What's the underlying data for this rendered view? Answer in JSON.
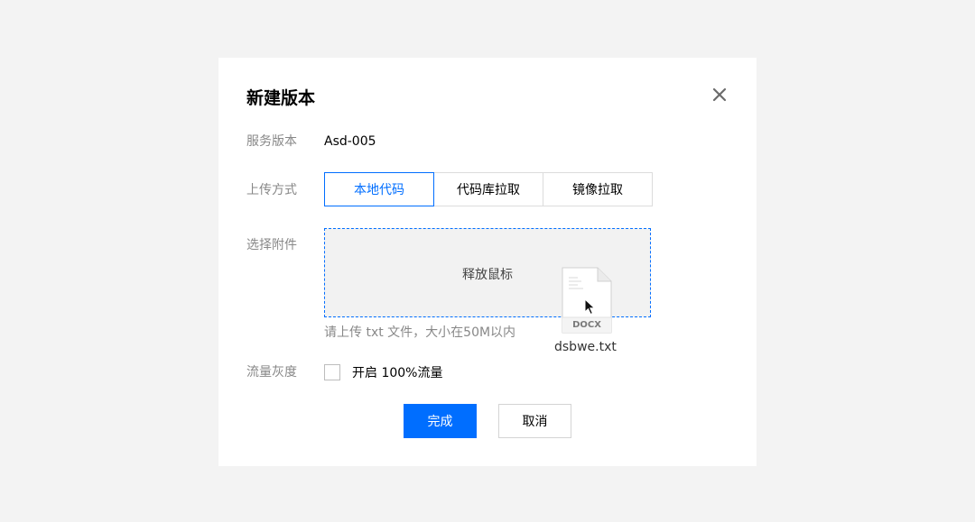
{
  "dialog": {
    "title": "新建版本",
    "close_icon": "close-icon"
  },
  "form": {
    "service_version": {
      "label": "服务版本",
      "value": "Asd-005"
    },
    "upload_method": {
      "label": "上传方式",
      "options": [
        "本地代码",
        "代码库拉取",
        "镜像拉取"
      ],
      "selected": "本地代码"
    },
    "attachment": {
      "label": "选择附件",
      "dropzone_text": "释放鼠标",
      "hint": "请上传 txt 文件，大小在50M以内",
      "dragging_file": {
        "icon": "docx-file-icon",
        "type_label": "DOCX",
        "name": "dsbwe.txt"
      }
    },
    "traffic_gray": {
      "label": "流量灰度",
      "checkbox_label": "开启 100%流量",
      "checked": false
    }
  },
  "actions": {
    "confirm_label": "完成",
    "cancel_label": "取消"
  },
  "colors": {
    "accent": "#006eff",
    "background": "#f3f3f3",
    "dropzone_bg": "#f2f2f2"
  }
}
